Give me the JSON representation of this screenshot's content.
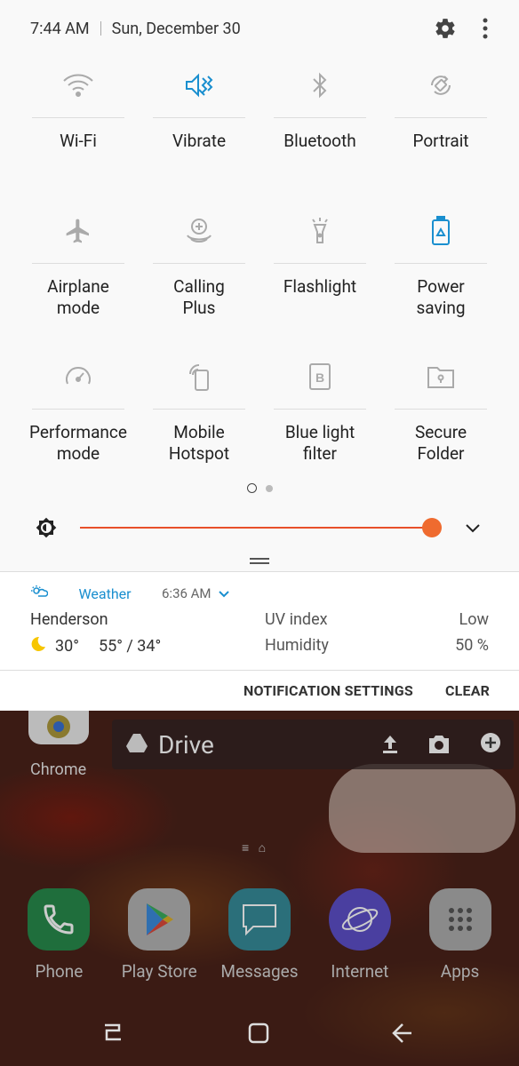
{
  "status": {
    "time": "7:44 AM",
    "date": "Sun, December 30"
  },
  "tiles": [
    {
      "label": "Wi-Fi",
      "icon": "wifi-icon",
      "active": false
    },
    {
      "label": "Vibrate",
      "icon": "vibrate-icon",
      "active": true
    },
    {
      "label": "Bluetooth",
      "icon": "bluetooth-icon",
      "active": false
    },
    {
      "label": "Portrait",
      "icon": "rotate-icon",
      "active": false
    },
    {
      "label": "Airplane\nmode",
      "icon": "airplane-icon",
      "active": false
    },
    {
      "label": "Calling\nPlus",
      "icon": "calling-plus-icon",
      "active": false
    },
    {
      "label": "Flashlight",
      "icon": "flashlight-icon",
      "active": false
    },
    {
      "label": "Power\nsaving",
      "icon": "battery-recycle-icon",
      "active": true
    },
    {
      "label": "Performance\nmode",
      "icon": "gauge-icon",
      "active": false
    },
    {
      "label": "Mobile\nHotspot",
      "icon": "hotspot-icon",
      "active": false
    },
    {
      "label": "Blue light\nfilter",
      "icon": "blue-light-icon",
      "active": false
    },
    {
      "label": "Secure\nFolder",
      "icon": "secure-folder-icon",
      "active": false
    }
  ],
  "brightness": {
    "level": 0.97
  },
  "notification": {
    "app": "Weather",
    "time": "6:36 AM",
    "location": "Henderson",
    "current_temp": "30°",
    "range": "55° / 34°",
    "uv_label": "UV index",
    "uv_value": "Low",
    "humidity_label": "Humidity",
    "humidity_value": "50 %"
  },
  "actions": {
    "settings": "NOTIFICATION SETTINGS",
    "clear": "CLEAR"
  },
  "home": {
    "chrome": "Chrome",
    "drive": "Drive",
    "apps": [
      "Phone",
      "Play Store",
      "Messages",
      "Internet",
      "Apps"
    ]
  },
  "colors": {
    "accent": "#1a8fcf",
    "brightness": "#ef6b2f"
  }
}
